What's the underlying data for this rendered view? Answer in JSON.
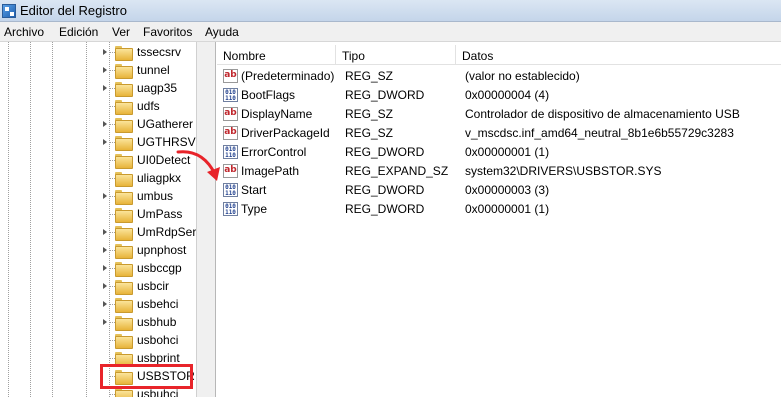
{
  "window": {
    "title": "Editor del Registro"
  },
  "menu": [
    "Archivo",
    "Edición",
    "Ver",
    "Favoritos",
    "Ayuda"
  ],
  "tree": {
    "items": [
      {
        "label": "tssecsrv",
        "expandable": true
      },
      {
        "label": "tunnel",
        "expandable": true
      },
      {
        "label": "uagp35",
        "expandable": true
      },
      {
        "label": "udfs",
        "expandable": false
      },
      {
        "label": "UGatherer",
        "expandable": true
      },
      {
        "label": "UGTHRSVC",
        "expandable": true
      },
      {
        "label": "UI0Detect",
        "expandable": false
      },
      {
        "label": "uliagpkx",
        "expandable": false
      },
      {
        "label": "umbus",
        "expandable": true
      },
      {
        "label": "UmPass",
        "expandable": false
      },
      {
        "label": "UmRdpSer",
        "expandable": true
      },
      {
        "label": "upnphost",
        "expandable": true
      },
      {
        "label": "usbccgp",
        "expandable": true
      },
      {
        "label": "usbcir",
        "expandable": true
      },
      {
        "label": "usbehci",
        "expandable": true
      },
      {
        "label": "usbhub",
        "expandable": true
      },
      {
        "label": "usbohci",
        "expandable": false
      },
      {
        "label": "usbprint",
        "expandable": false
      },
      {
        "label": "USBSTOR",
        "expandable": false,
        "selected": true
      },
      {
        "label": "usbuhci",
        "expandable": false
      }
    ]
  },
  "columns": {
    "name": "Nombre",
    "type": "Tipo",
    "data": "Datos"
  },
  "values": [
    {
      "icon": "string-value-icon",
      "name": "(Predeterminado)",
      "type": "REG_SZ",
      "data": "(valor no establecido)"
    },
    {
      "icon": "binary-value-icon",
      "name": "BootFlags",
      "type": "REG_DWORD",
      "data": "0x00000004 (4)"
    },
    {
      "icon": "string-value-icon",
      "name": "DisplayName",
      "type": "REG_SZ",
      "data": "Controlador de dispositivo de almacenamiento USB"
    },
    {
      "icon": "string-value-icon",
      "name": "DriverPackageId",
      "type": "REG_SZ",
      "data": "v_mscdsc.inf_amd64_neutral_8b1e6b55729c3283"
    },
    {
      "icon": "binary-value-icon",
      "name": "ErrorControl",
      "type": "REG_DWORD",
      "data": "0x00000001 (1)"
    },
    {
      "icon": "string-value-icon",
      "name": "ImagePath",
      "type": "REG_EXPAND_SZ",
      "data": "system32\\DRIVERS\\USBSTOR.SYS"
    },
    {
      "icon": "binary-value-icon",
      "name": "Start",
      "type": "REG_DWORD",
      "data": "0x00000003 (3)"
    },
    {
      "icon": "binary-value-icon",
      "name": "Type",
      "type": "REG_DWORD",
      "data": "0x00000001 (1)"
    }
  ],
  "colors": {
    "annotation_red": "#e8242a"
  }
}
